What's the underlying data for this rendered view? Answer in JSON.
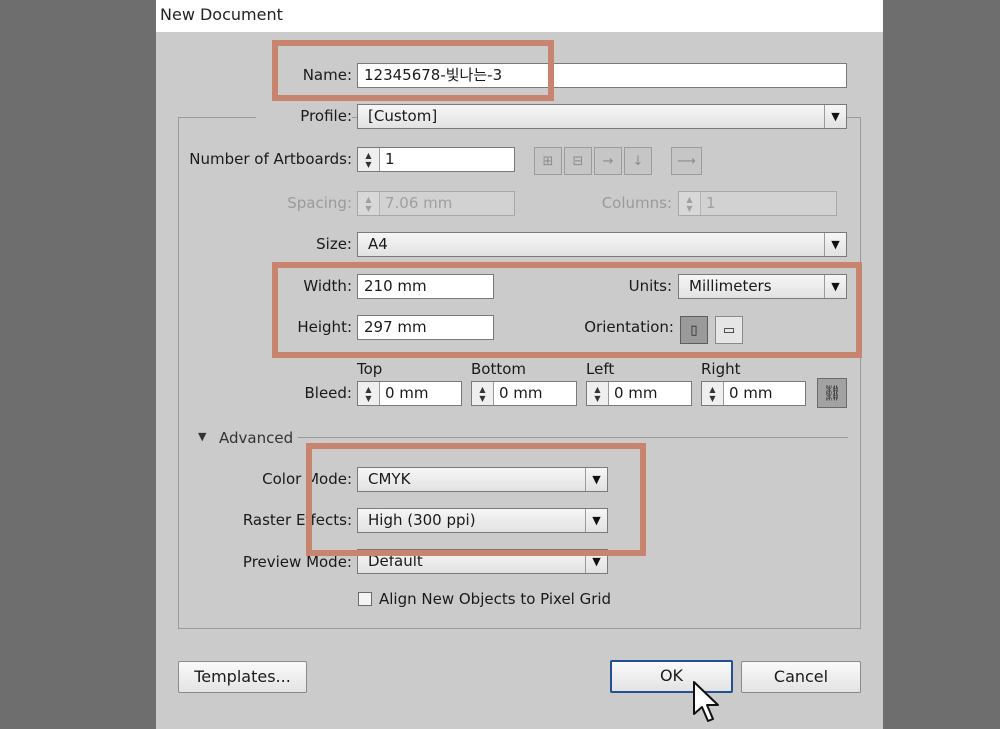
{
  "window": {
    "title": "New Document"
  },
  "name": {
    "label": "Name:",
    "value": "12345678-빛나는-3"
  },
  "profile": {
    "label": "Profile:",
    "value": "[Custom]"
  },
  "artboards": {
    "count_label": "Number of Artboards:",
    "count_value": "1",
    "arrangement_icons": [
      "grid-by-row-icon",
      "grid-by-column-icon",
      "arrange-by-row-icon",
      "arrange-by-column-icon",
      "right-to-left-icon"
    ],
    "spacing_label": "Spacing:",
    "spacing_value": "7.06 mm",
    "columns_label": "Columns:",
    "columns_value": "1"
  },
  "size": {
    "label": "Size:",
    "value": "A4"
  },
  "width": {
    "label": "Width:",
    "value": "210 mm"
  },
  "height": {
    "label": "Height:",
    "value": "297 mm"
  },
  "units": {
    "label": "Units:",
    "value": "Millimeters"
  },
  "orientation": {
    "label": "Orientation:",
    "selected": "portrait"
  },
  "bleed": {
    "label": "Bleed:",
    "top_label": "Top",
    "top_value": "0 mm",
    "bottom_label": "Bottom",
    "bottom_value": "0 mm",
    "left_label": "Left",
    "left_value": "0 mm",
    "right_label": "Right",
    "right_value": "0 mm",
    "link_icon": "chain-link-icon"
  },
  "advanced": {
    "toggle_label": "Advanced",
    "color_mode_label": "Color Mode:",
    "color_mode_value": "CMYK",
    "raster_label": "Raster Effects:",
    "raster_value": "High (300 ppi)",
    "preview_label": "Preview Mode:",
    "preview_value": "Default",
    "pixel_grid_label": "Align New Objects to Pixel Grid",
    "pixel_grid_checked": false
  },
  "buttons": {
    "templates": "Templates...",
    "ok": "OK",
    "cancel": "Cancel"
  },
  "colors": {
    "highlight": "#c98470",
    "dialog_bg": "#cbcbcb",
    "ok_border": "#23508f"
  }
}
